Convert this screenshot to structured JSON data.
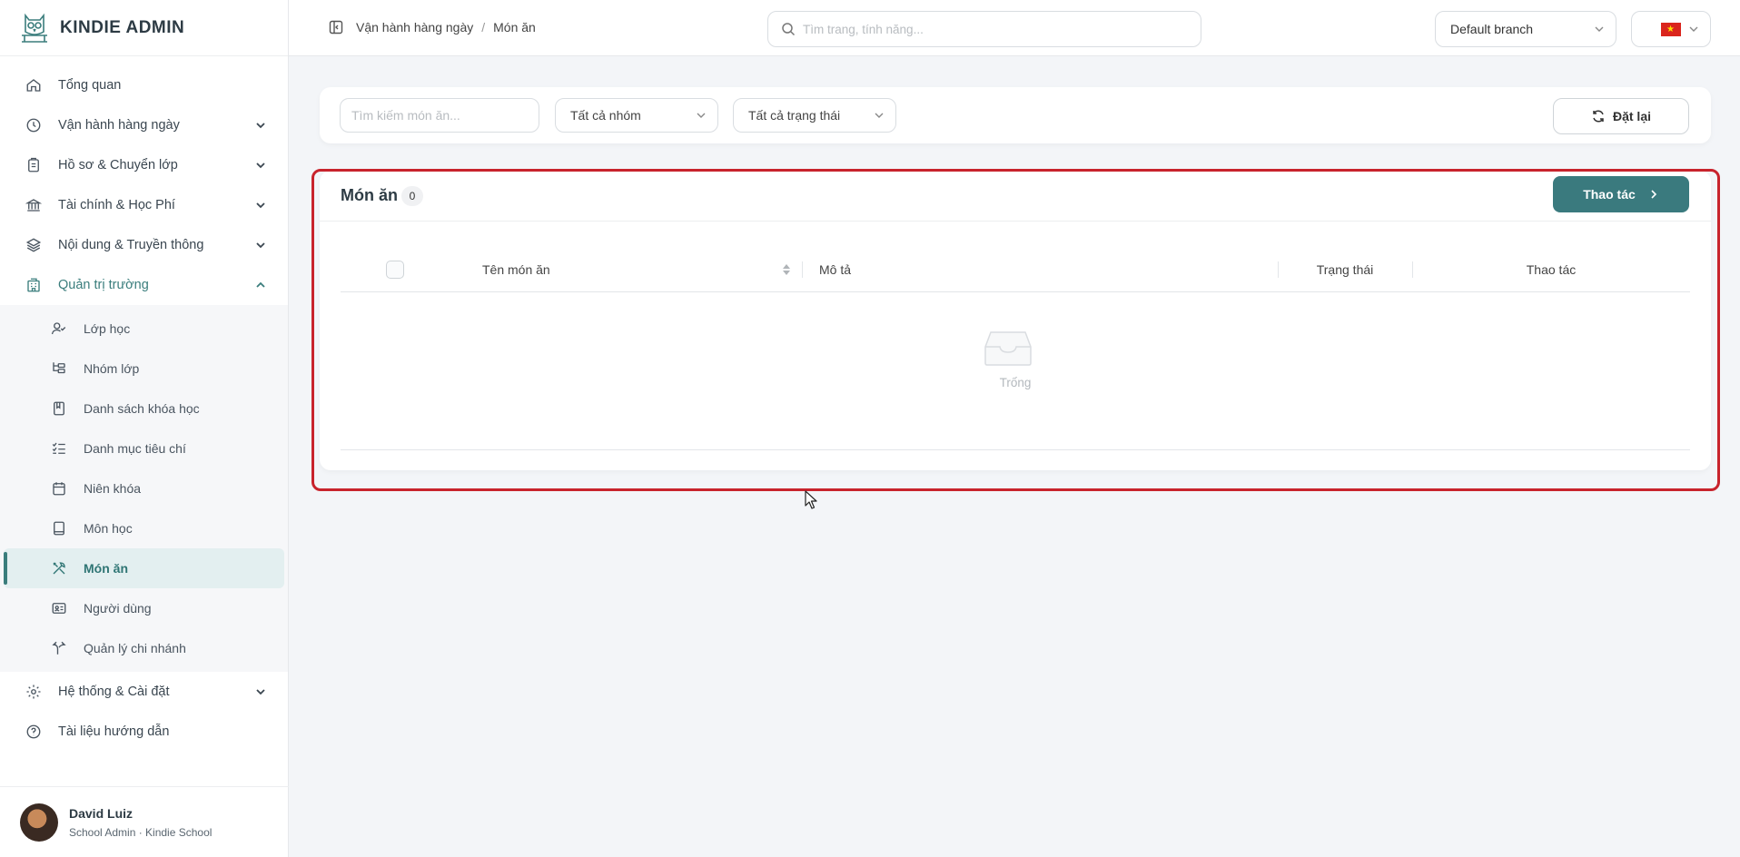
{
  "app": {
    "brand": "KINDIE ADMIN"
  },
  "sidebar": {
    "items": [
      {
        "label": "Tổng quan",
        "icon": "home-icon"
      },
      {
        "label": "Vận hành hàng ngày",
        "icon": "clock-icon"
      },
      {
        "label": "Hồ sơ & Chuyển lớp",
        "icon": "clipboard-icon"
      },
      {
        "label": "Tài chính & Học Phí",
        "icon": "bank-icon"
      },
      {
        "label": "Nội dung & Truyền thông",
        "icon": "layers-icon"
      },
      {
        "label": "Quản trị trường",
        "icon": "school-icon"
      }
    ],
    "subitems": [
      {
        "label": "Lớp học",
        "icon": "user-check-icon"
      },
      {
        "label": "Nhóm lớp",
        "icon": "tree-icon"
      },
      {
        "label": "Danh sách khóa học",
        "icon": "book-icon"
      },
      {
        "label": "Danh mục tiêu chí",
        "icon": "list-check-icon"
      },
      {
        "label": "Niên khóa",
        "icon": "calendar-icon"
      },
      {
        "label": "Môn học",
        "icon": "notebook-icon"
      },
      {
        "label": "Món ăn",
        "icon": "utensils-icon"
      },
      {
        "label": "Người dùng",
        "icon": "id-card-icon"
      },
      {
        "label": "Quản lý chi nhánh",
        "icon": "branch-icon"
      }
    ],
    "bottom_items": [
      {
        "label": "Hệ thống & Cài đặt",
        "icon": "gear-icon"
      },
      {
        "label": "Tài liệu hướng dẫn",
        "icon": "help-icon"
      }
    ],
    "selected": "Món ăn"
  },
  "user": {
    "name": "David Luiz",
    "role": "School Admin · Kindie School"
  },
  "topbar": {
    "breadcrumb": [
      "Vận hành hàng ngày",
      "Món ăn"
    ],
    "search_placeholder": "Tìm trang, tính năng...",
    "branch": "Default branch"
  },
  "filters": {
    "search_placeholder": "Tìm kiếm món ăn...",
    "group_select": "Tất cả nhóm",
    "status_select": "Tất cả trạng thái",
    "reset_label": "Đặt lại"
  },
  "table": {
    "title": "Món ăn",
    "count": "0",
    "action_label": "Thao tác",
    "columns": [
      "Tên món ăn",
      "Mô tả",
      "Trạng thái",
      "Thao tác"
    ],
    "empty_text": "Trống"
  },
  "colors": {
    "accent": "#3a7d7c",
    "highlight": "#c8232c"
  }
}
